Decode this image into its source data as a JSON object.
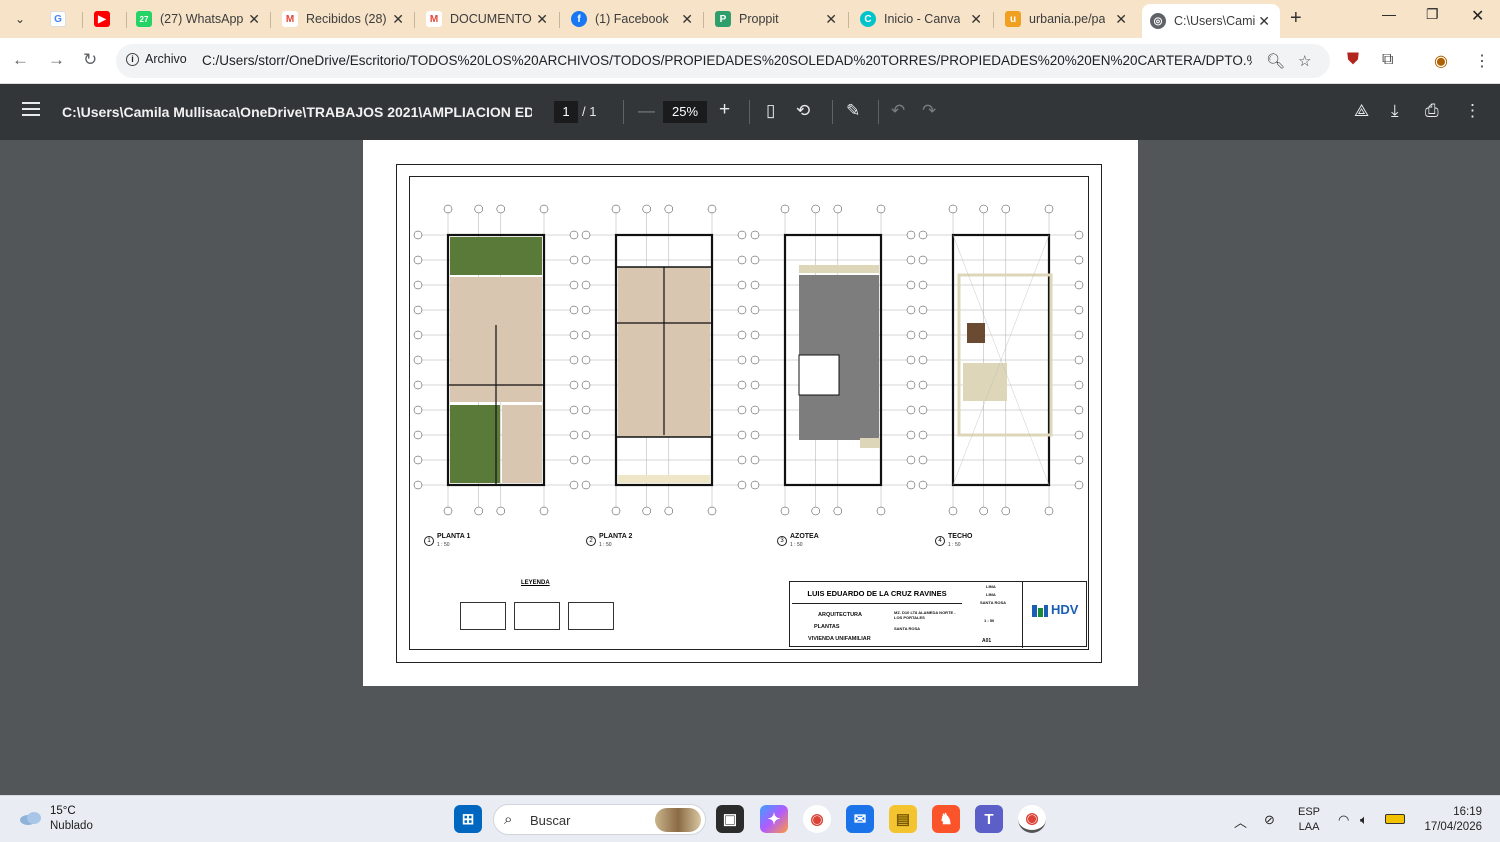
{
  "tabs": [
    {
      "title": "",
      "favicon": "google-icon",
      "color": "#ffffff"
    },
    {
      "title": "",
      "favicon": "youtube-icon",
      "color": "#ff0000"
    },
    {
      "title": "(27) WhatsApp",
      "favicon": "whatsapp-icon",
      "color": "#25d366"
    },
    {
      "title": "Recibidos (28)",
      "favicon": "gmail-icon",
      "color": "#ea4335"
    },
    {
      "title": "DOCUMENTO",
      "favicon": "gmail-icon",
      "color": "#ea4335"
    },
    {
      "title": "(1) Facebook",
      "favicon": "facebook-icon",
      "color": "#1877f2"
    },
    {
      "title": "Proppit",
      "favicon": "proppit-icon",
      "color": "#2e9e6a"
    },
    {
      "title": "Inicio - Canva",
      "favicon": "canva-icon",
      "color": "#00c4cc"
    },
    {
      "title": "urbania.pe/pa",
      "favicon": "urbania-icon",
      "color": "#f0a020"
    },
    {
      "title": "C:\\Users\\Cami",
      "favicon": "globe-icon",
      "color": "#5f6368"
    }
  ],
  "omnibox": {
    "chip": "Archivo",
    "url": "C:/Users/storr/OneDrive/Escritorio/TODOS%20LOS%20ARCHIVOS/TODOS/PROPIEDADES%20SOLEDAD%20TORRES/PROPIEDADES%20%20EN%20CARTERA/DPTO.%20SANT..."
  },
  "pdf": {
    "title": "C:\\Users\\Camila Mullisaca\\OneDrive\\TRABAJOS 2021\\AMPLIACION EDUA...",
    "page": "1",
    "page_total": "/  1",
    "zoom": "25%"
  },
  "drawing": {
    "plans": [
      {
        "num": "1",
        "label": "PLANTA 1",
        "scale": "1 : 50"
      },
      {
        "num": "2",
        "label": "PLANTA 2",
        "scale": "1 : 50"
      },
      {
        "num": "3",
        "label": "AZOTEA",
        "scale": "1 : 50"
      },
      {
        "num": "4",
        "label": "TECHO",
        "scale": "1 : 50"
      }
    ],
    "leyenda": "LEYENDA",
    "titleblock": {
      "owner": "LUIS EDUARDO DE LA CRUZ RAVINES",
      "specialty": "ARQUITECTURA",
      "sheet_content": "PLANTAS",
      "project": "VIVIENDA UNIFAMILIAR",
      "address": "MZ. D10 LT8 ALAMEDA NORTE - LOS PORTALES",
      "district": "SANTA ROSA",
      "dept": "LIMA",
      "province": "LIMA",
      "district2": "SANTA ROSA",
      "scale": "1 : 50",
      "sheet": "A01",
      "logo": "HDV"
    }
  },
  "taskbar": {
    "temp": "15°C",
    "weather": "Nublado",
    "search": "Buscar",
    "lang1": "ESP",
    "lang2": "LAA",
    "time": "16:19",
    "date": "17/04/2026"
  }
}
